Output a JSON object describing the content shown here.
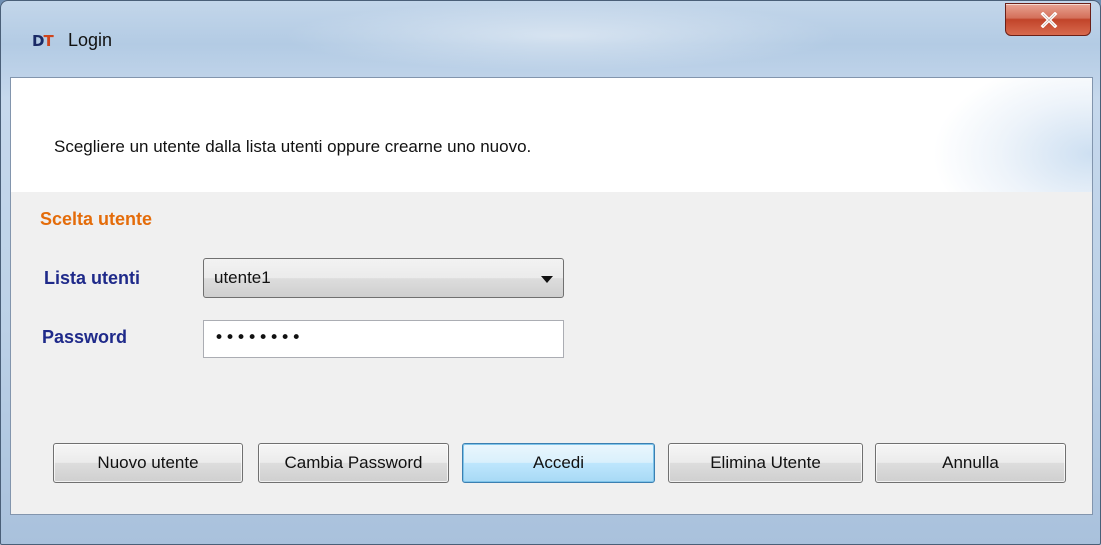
{
  "window": {
    "title": "Login",
    "icon": {
      "name": "dt-app-icon",
      "letters": [
        "D",
        "T"
      ],
      "colors": [
        "#1a2a66",
        "#d0441c"
      ]
    }
  },
  "titlebar": {
    "close_icon": "close-icon"
  },
  "banner": {
    "instruction": "Scegliere un utente dalla lista utenti oppure crearne uno nuovo."
  },
  "section": {
    "title": "Scelta utente",
    "title_color": "#e46c0a"
  },
  "form": {
    "user_label": "Lista utenti",
    "user_selected": "utente1",
    "password_label": "Password",
    "password_masked": "••••••••",
    "label_color": "#1f2a8a"
  },
  "buttons": {
    "new_user": "Nuovo utente",
    "change_password": "Cambia Password",
    "login": "Accedi",
    "delete_user": "Elimina Utente",
    "cancel": "Annulla"
  }
}
